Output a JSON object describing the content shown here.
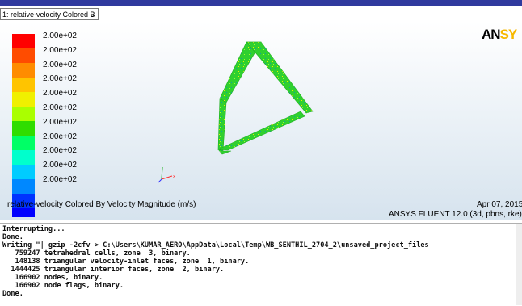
{
  "display": {
    "selector_label": "1: relative-velocity Colored B",
    "selector_icon": "chevron-down-icon",
    "logo_left": "AN",
    "logo_right": "SY",
    "caption": "relative-velocity Colored By Velocity Magnitude (m/s)",
    "date": "Apr 07, 2015",
    "version": "ANSYS FLUENT 12.0 (3d, pbns, rke)"
  },
  "colormap": {
    "labels": [
      "2.00e+02",
      "2.00e+02",
      "2.00e+02",
      "2.00e+02",
      "2.00e+02",
      "2.00e+02",
      "2.00e+02",
      "2.00e+02",
      "2.00e+02",
      "2.00e+02",
      "2.00e+02"
    ],
    "colors": [
      "#ff0000",
      "#ff4c00",
      "#ff8c00",
      "#ffc400",
      "#f0f000",
      "#aaff00",
      "#30dd00",
      "#00ff66",
      "#00ffcc",
      "#00ccff",
      "#0088ff",
      "#0033ff",
      "#0000ff"
    ]
  },
  "console": {
    "lines": [
      "Interrupting...",
      "Done.",
      "Writing \"| gzip -2cfv > C:\\Users\\KUMAR_AERO\\AppData\\Local\\Temp\\WB_SENTHIL_2704_2\\unsaved_project_files",
      "   759247 tetrahedral cells, zone  3, binary.",
      "   148138 triangular velocity-inlet faces, zone  1, binary.",
      "  1444425 triangular interior faces, zone  2, binary.",
      "   166902 nodes, binary.",
      "   166902 node flags, binary.",
      "Done."
    ]
  }
}
